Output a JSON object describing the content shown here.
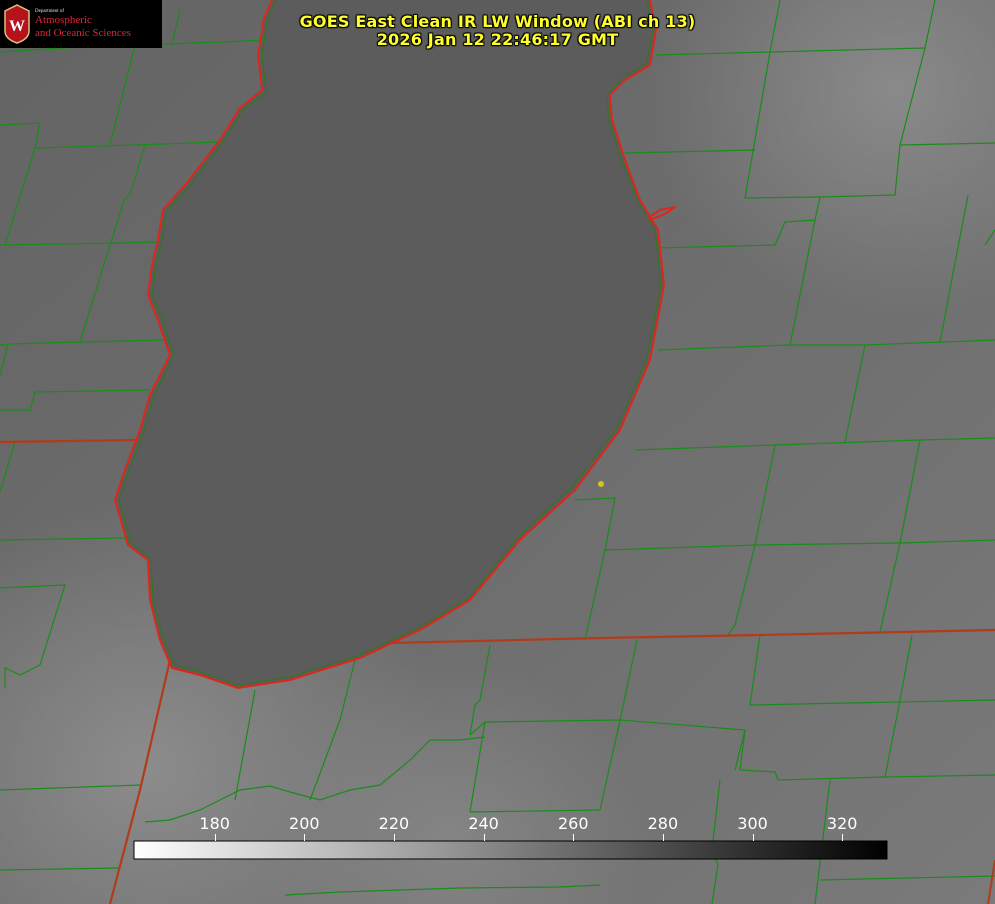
{
  "title": {
    "line1": "GOES East Clean IR LW Window (ABI ch 13)",
    "line2": "2026 Jan 12 22:46:17 GMT",
    "color": "#ffff2e"
  },
  "logo": {
    "dept_small": "Department of",
    "line1": "Atmospheric",
    "line2": "and Oceanic Sciences",
    "icon": "uw-seal-icon",
    "accent": "#e0253b"
  },
  "colorbar": {
    "min": 162,
    "max": 330,
    "ticks": [
      "180",
      "200",
      "220",
      "240",
      "260",
      "280",
      "300",
      "320"
    ],
    "gradient": "white-to-black"
  },
  "map": {
    "lake": "lake-michigan",
    "marker": "yellow dot",
    "line_colors": {
      "county": "#1a8c1a",
      "state": "#e0251b",
      "coast": "#e0251b"
    }
  }
}
